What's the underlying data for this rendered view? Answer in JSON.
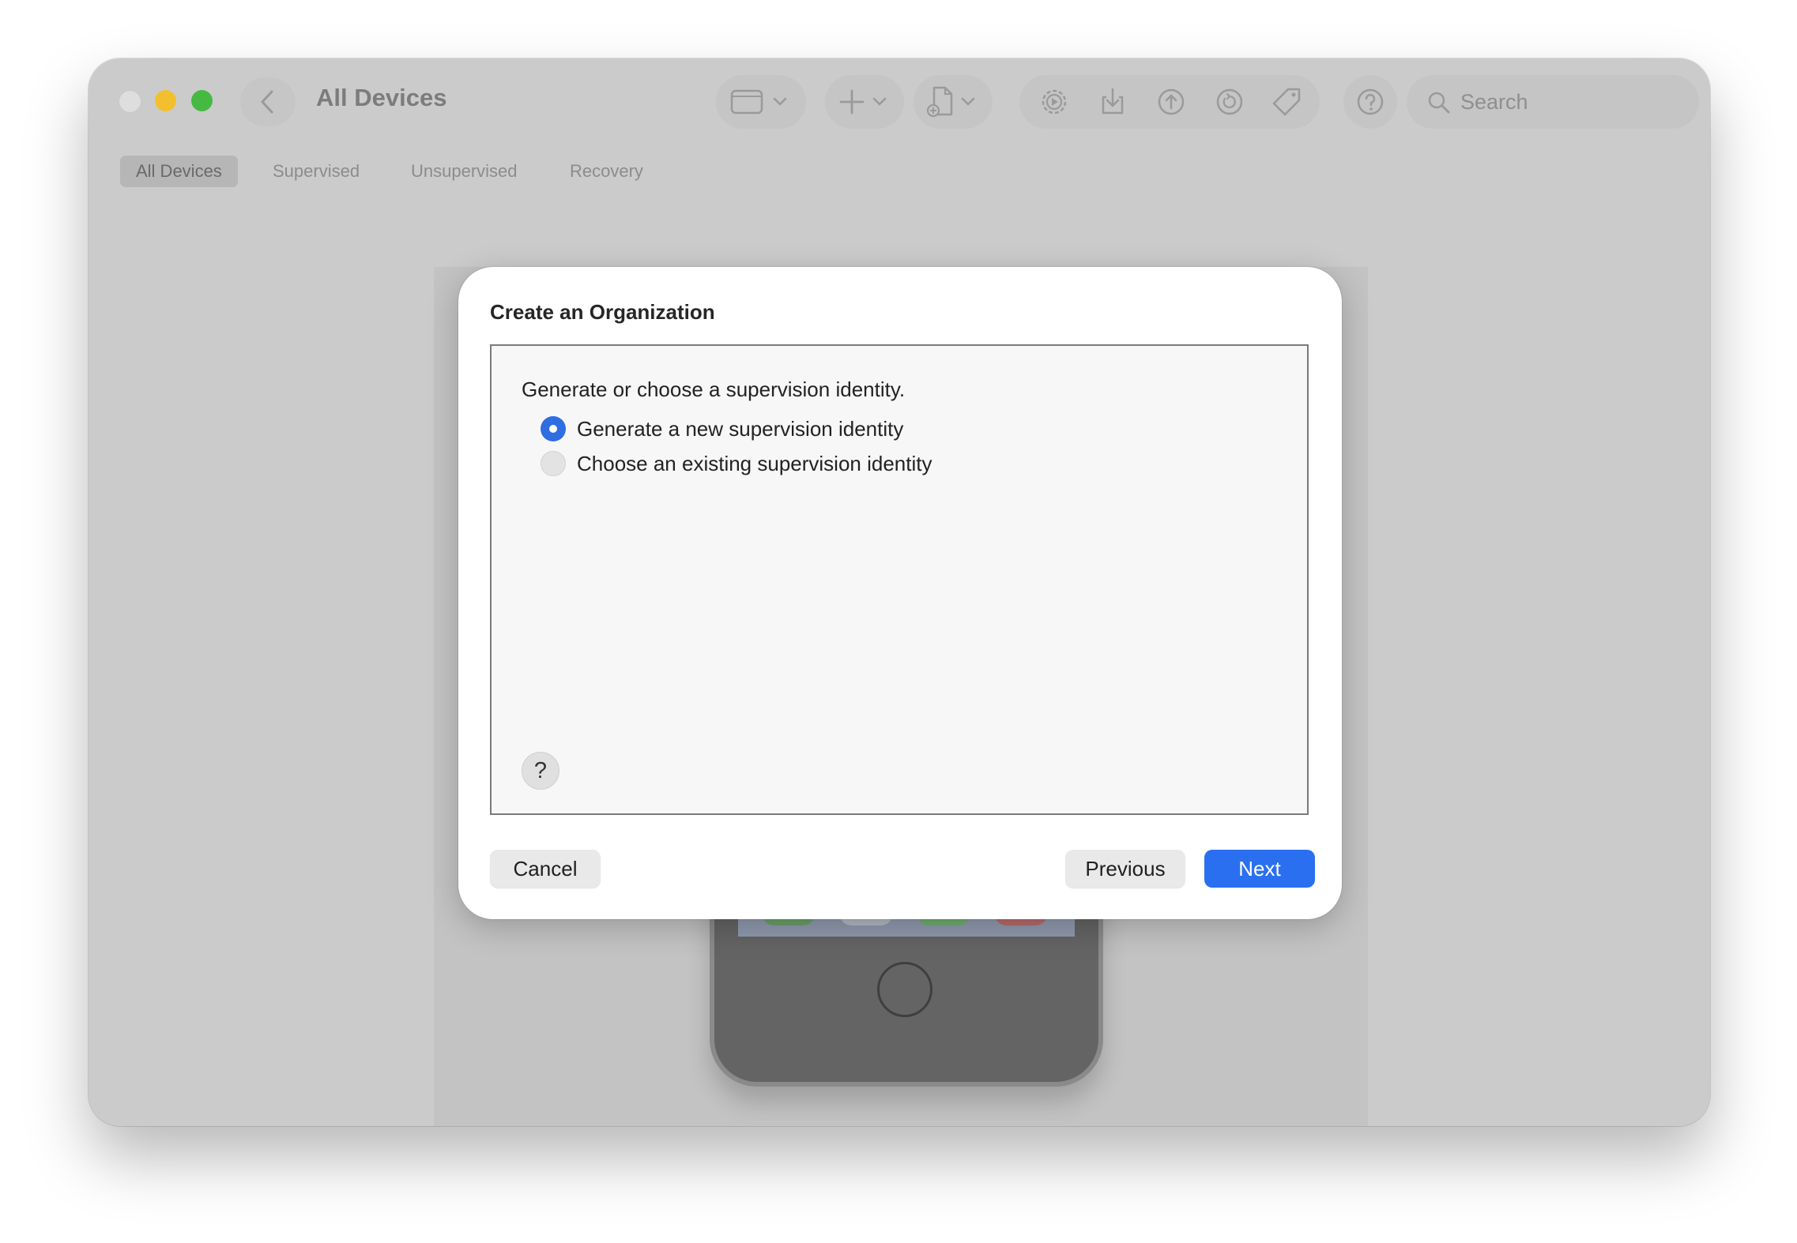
{
  "window": {
    "title": "All Devices"
  },
  "toolbar": {
    "search_placeholder": "Search"
  },
  "tabs": [
    {
      "label": "All Devices",
      "active": true
    },
    {
      "label": "Supervised",
      "active": false
    },
    {
      "label": "Unsupervised",
      "active": false
    },
    {
      "label": "Recovery",
      "active": false
    }
  ],
  "sheet": {
    "title": "Create an Organization",
    "prompt": "Generate or choose a supervision identity.",
    "options": [
      {
        "label": "Generate a new supervision identity",
        "selected": true
      },
      {
        "label": "Choose an existing supervision identity",
        "selected": false
      }
    ],
    "help_label": "?",
    "cancel_label": "Cancel",
    "previous_label": "Previous",
    "next_label": "Next"
  },
  "colors": {
    "accent": "#2a6ff0",
    "window_bg": "#cbcbcb",
    "close": "#dedede",
    "minimize": "#f4bf2e",
    "zoom": "#46b942"
  },
  "icons": [
    "chevron-left-icon",
    "sidebar-window-icon",
    "plus-icon",
    "add-document-icon",
    "settings-gear-icon",
    "download-icon",
    "upload-icon",
    "restore-icon",
    "tag-icon",
    "help-icon",
    "search-icon"
  ]
}
